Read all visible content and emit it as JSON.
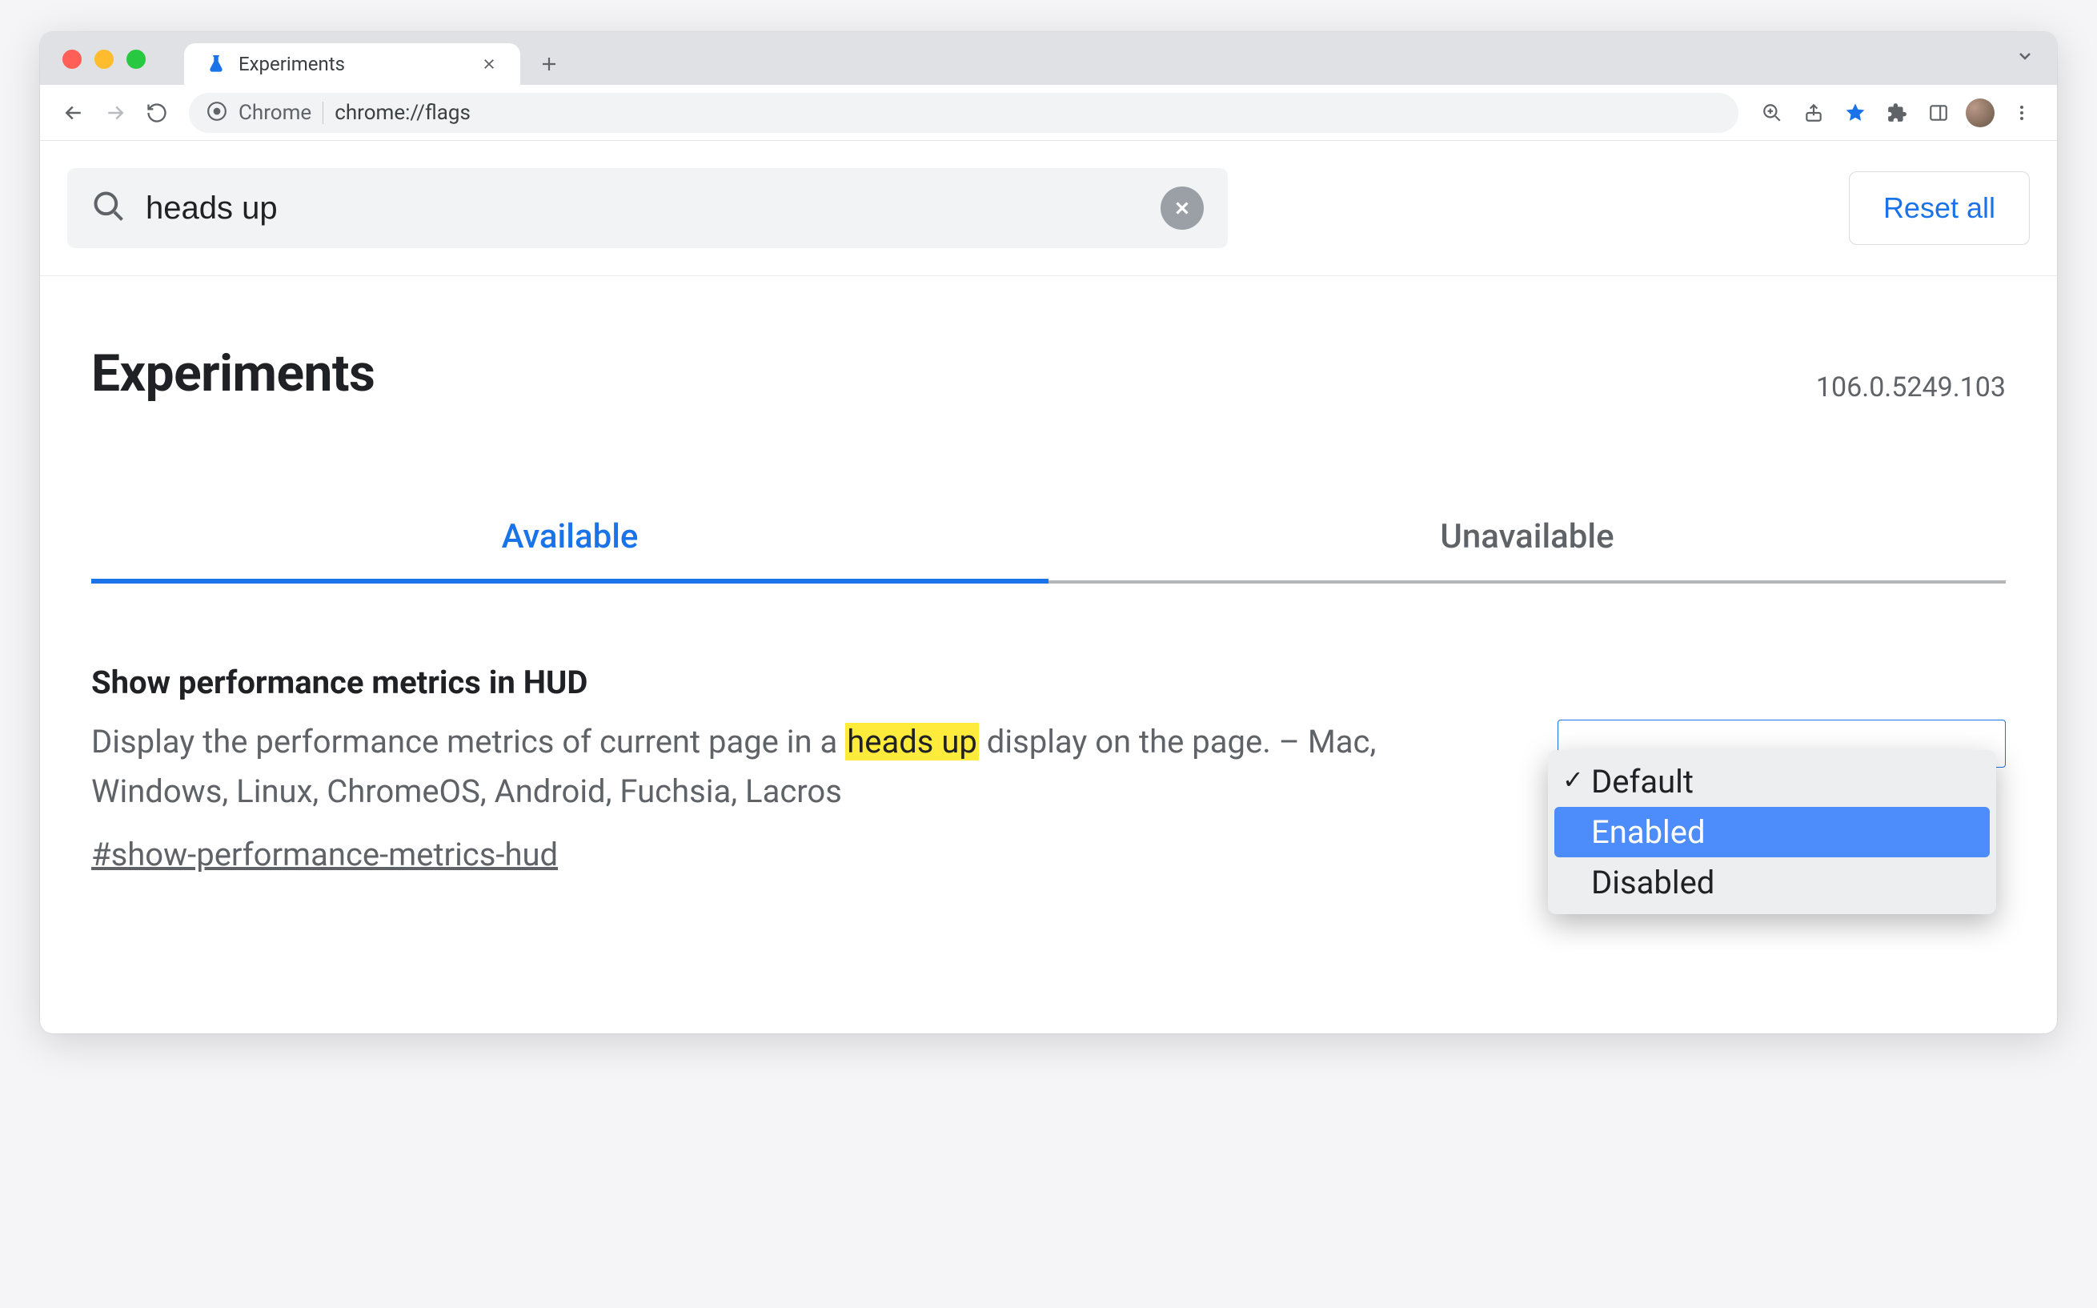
{
  "window": {
    "tab_title": "Experiments",
    "omnibox_label": "Chrome",
    "omnibox_url": "chrome://flags"
  },
  "search": {
    "value": "heads up",
    "reset_label": "Reset all"
  },
  "header": {
    "title": "Experiments",
    "version": "106.0.5249.103"
  },
  "tabs": {
    "available": "Available",
    "unavailable": "Unavailable"
  },
  "flag": {
    "title": "Show performance metrics in HUD",
    "desc_before": "Display the performance metrics of current page in a ",
    "highlight": "heads up",
    "desc_after": " display on the page. – Mac, Windows, Linux, ChromeOS, Android, Fuchsia, Lacros",
    "anchor": "#show-performance-metrics-hud",
    "options": {
      "default": "Default",
      "enabled": "Enabled",
      "disabled": "Disabled"
    }
  }
}
